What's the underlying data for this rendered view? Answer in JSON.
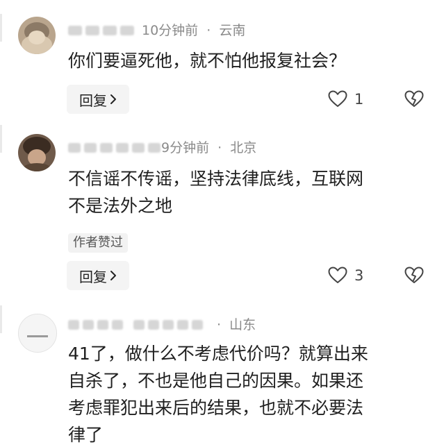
{
  "comments": [
    {
      "time": "10分钟前",
      "location": "云南",
      "text_lines": [
        "你们要逼死他，就不怕他报复社会？"
      ],
      "reply_label": "回复",
      "likes": "1",
      "author_liked": ""
    },
    {
      "time": "9分钟前",
      "location": "北京",
      "text_lines": [
        "不信谣不传谣，坚持法律底线，互联网",
        "不是法外之地"
      ],
      "reply_label": "回复",
      "likes": "3",
      "author_liked": "作者赞过"
    },
    {
      "time": "",
      "location": "山东",
      "text_lines": [
        "41了，做什么不考虑代价吗？就算出来",
        "自杀了，不也是他自己的因果。如果还",
        "考虑罪犯出来后的结果，也就不必要法",
        "律了"
      ],
      "reply_label": "",
      "likes": "",
      "author_liked": ""
    }
  ],
  "separator": "·",
  "colors": {
    "text": "#1f1f1f",
    "meta": "#8a8a8a",
    "button_bg": "#f4f4f4"
  }
}
